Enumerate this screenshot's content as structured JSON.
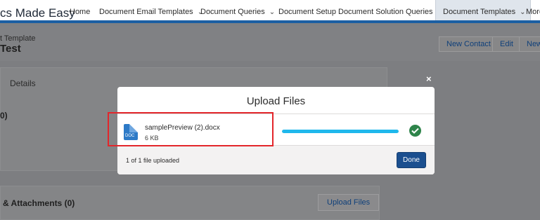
{
  "app": {
    "name": "cs Made Easy"
  },
  "nav": {
    "items": [
      {
        "label": "Home",
        "has_chevron": false
      },
      {
        "label": "Document Email Templates",
        "has_chevron": true
      },
      {
        "label": "Document Queries",
        "has_chevron": true
      },
      {
        "label": "Document Setup",
        "has_chevron": false
      },
      {
        "label": "Document Solution Queries",
        "has_chevron": true
      },
      {
        "label": "Document Templates",
        "has_chevron": true,
        "active": true
      },
      {
        "label": "More",
        "has_chevron": false
      }
    ],
    "chevron": "⌄"
  },
  "record": {
    "object_label": "t Template",
    "title": "Test",
    "buttons": [
      "New Contact",
      "Edit",
      "New"
    ]
  },
  "background": {
    "details_tab": "Details",
    "related_count": "0)",
    "attachments_heading": "& Attachments (0)",
    "upload_button": "Upload Files"
  },
  "modal": {
    "close": "×",
    "title": "Upload Files",
    "file": {
      "name": "samplePreview (2).docx",
      "size": "6 KB",
      "icon": "doc-file-icon",
      "icon_text": "DOC",
      "progress": 1.0,
      "status_icon": "check-circle-icon"
    },
    "footer_status": "1 of 1 file uploaded",
    "done_label": "Done"
  },
  "colors": {
    "brand_bar": "#1b5fa3",
    "progress": "#1fb8ec",
    "success": "#2e844a",
    "done_button": "#1b4f8f",
    "highlight": "#e3262b"
  }
}
